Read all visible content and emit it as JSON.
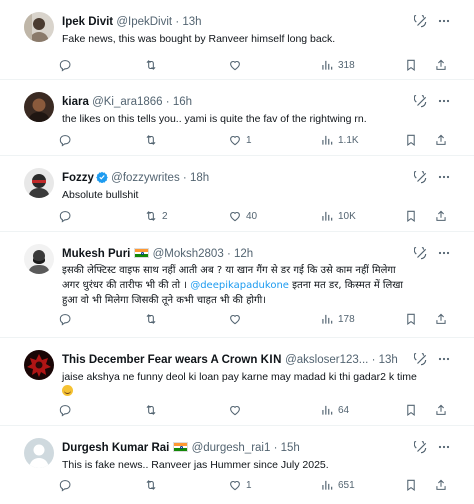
{
  "tweets": [
    {
      "name": "Ipek Divit",
      "handle": "@IpekDivit",
      "time": "13h",
      "text": "Fake news, this was bought by Ranveer himself long back.",
      "replies": "",
      "reposts": "",
      "likes": "",
      "views": "318"
    },
    {
      "name": "kiara",
      "handle": "@Ki_ara1866",
      "time": "16h",
      "text": "the likes on this tells you.. yami is quite the fav of the rightwing rn.",
      "replies": "",
      "reposts": "",
      "likes": "1",
      "views": "1.1K"
    },
    {
      "name": "Fozzy",
      "handle": "@fozzywrites",
      "time": "18h",
      "text": "Absolute bullshit",
      "replies": "",
      "reposts": "2",
      "likes": "40",
      "views": "10K"
    },
    {
      "name": "Mukesh Puri",
      "handle": "@Moksh2803",
      "time": "12h",
      "text_line1": "इसकी लेफ्टिस्ट वाइफ साथ नहीं आती अब ? या खान गैंग से डर गई कि उसे काम नहीं मिलेगा",
      "text_line2_pre": "अगर धुरंधर की तारीफ भी की तो । ",
      "mention": "@deepikapadukone",
      "text_line2_post": " इतना मत डर, किस्मत में लिखा",
      "text_line3": "हुआ वो भी मिलेगा जिसकी तूने कभी चाहत भी की होगी।",
      "replies": "",
      "reposts": "",
      "likes": "",
      "views": "178"
    },
    {
      "name": "This December Fear wears A Crown",
      "name_suffix": "KIN",
      "handle": "@aksloser123...",
      "time": "13h",
      "text": "jaise akshya ne funny deol ki loan pay karne may madad ki thi gadar2 k time",
      "replies": "",
      "reposts": "",
      "likes": "",
      "views": "64"
    },
    {
      "name": "Durgesh Kumar Rai",
      "handle": "@durgesh_rai1",
      "time": "15h",
      "text": "This is fake news.. Ranveer jas Hummer since July 2025.",
      "replies": "",
      "reposts": "",
      "likes": "1",
      "views": "651"
    }
  ],
  "separator": "·",
  "colors": {
    "text": "#0f1419",
    "secondary": "#536471",
    "link": "#1d9bf0",
    "divider": "#eff3f4"
  }
}
